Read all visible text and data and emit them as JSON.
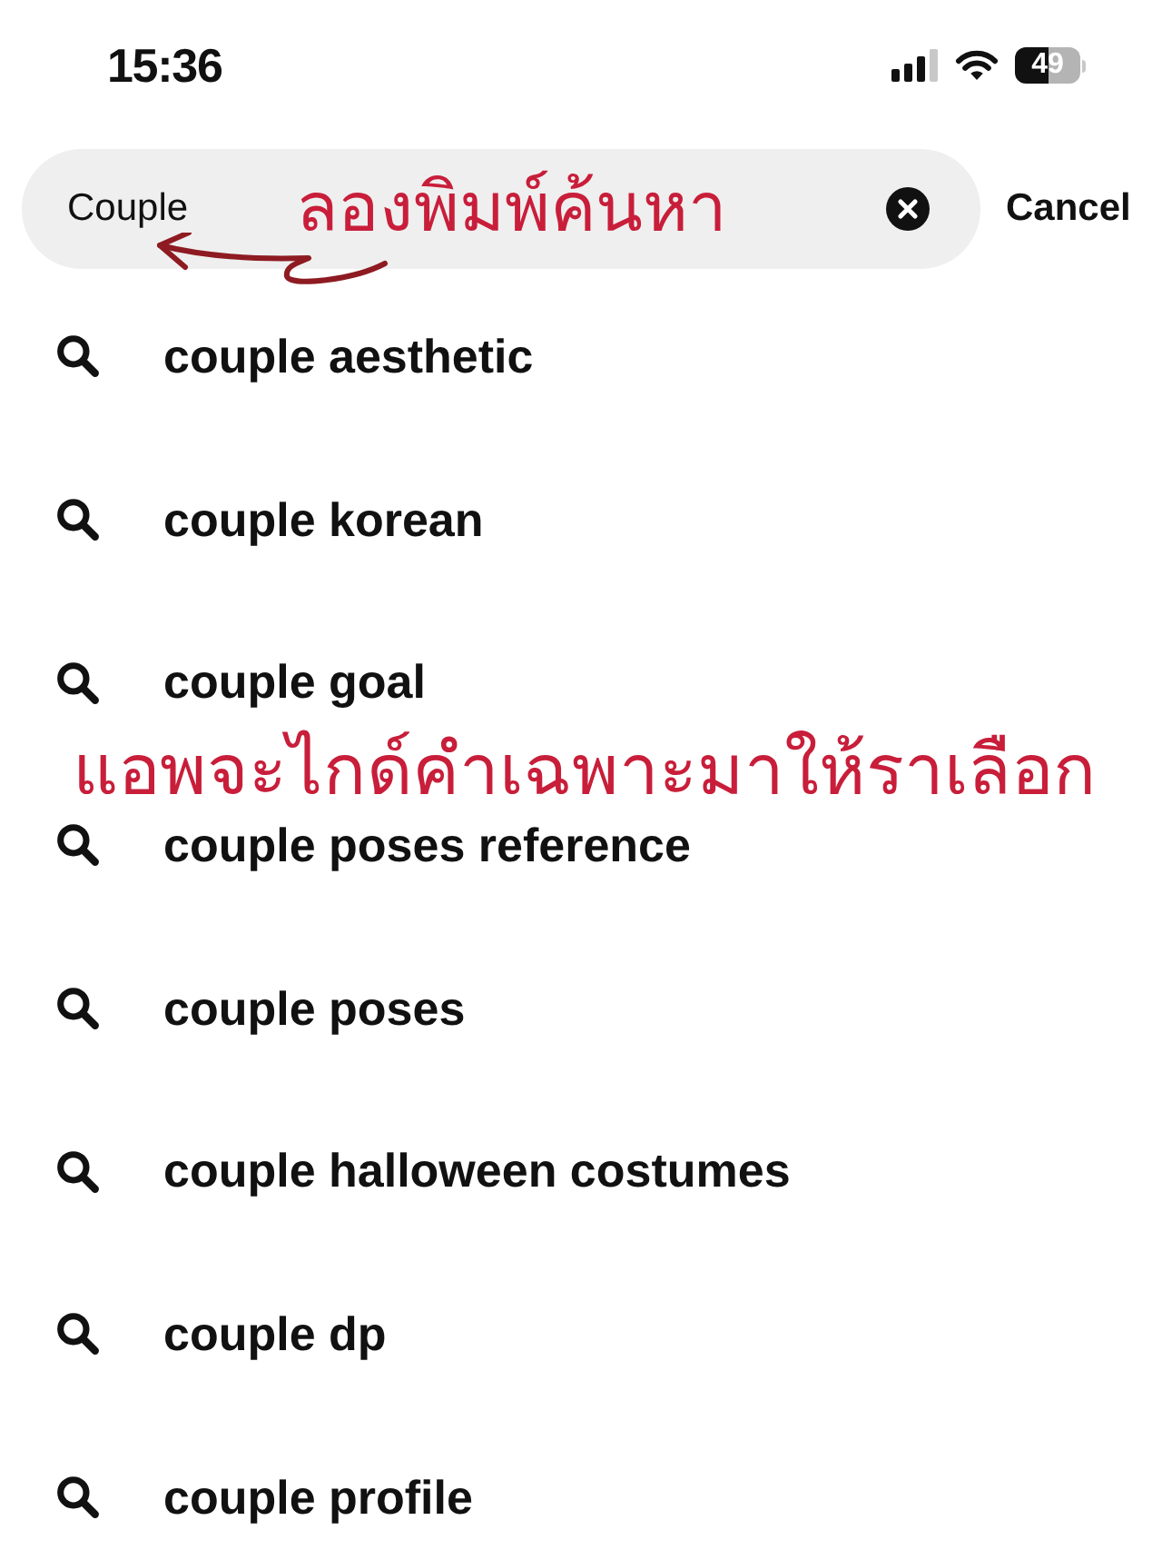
{
  "status_bar": {
    "time": "15:36",
    "battery": "49"
  },
  "search": {
    "value": "Couple",
    "note": "ลองพิมพ์ค้นหา",
    "cancel": "Cancel"
  },
  "suggestions_note": "แอพจะไกด์คำเฉพาะมาให้ราเลือก",
  "suggestions": [
    "couple aesthetic",
    "couple korean",
    "couple goal",
    "couple poses reference",
    "couple poses",
    "couple halloween costumes",
    "couple dp",
    "couple profile"
  ]
}
